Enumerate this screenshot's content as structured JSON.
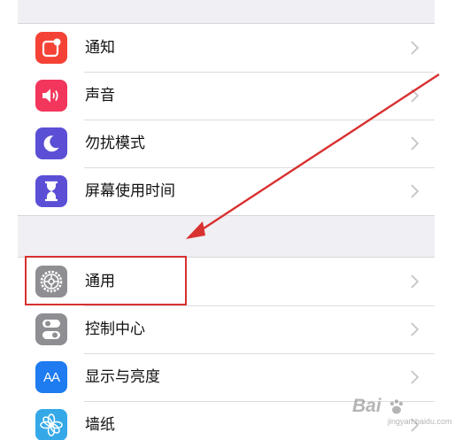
{
  "settings": {
    "group1": [
      {
        "label": "通知",
        "icon": "notifications-icon",
        "color": "#f44336"
      },
      {
        "label": "声音",
        "icon": "sound-icon",
        "color": "#f2365c"
      },
      {
        "label": "勿扰模式",
        "icon": "moon-icon",
        "color": "#5b4fd6"
      },
      {
        "label": "屏幕使用时间",
        "icon": "hourglass-icon",
        "color": "#5b4fd6"
      }
    ],
    "group2": [
      {
        "label": "通用",
        "icon": "gear-icon",
        "color": "#8e8e93"
      },
      {
        "label": "控制中心",
        "icon": "toggles-icon",
        "color": "#8e8e93"
      },
      {
        "label": "显示与亮度",
        "icon": "display-aa-icon",
        "color": "#1e7bf0",
        "icon_text": "AA"
      },
      {
        "label": "墙纸",
        "icon": "wallpaper-flower-icon",
        "color": "#35a9e8"
      }
    ]
  },
  "watermark": {
    "text": "Bai",
    "sub": "jingyan.baidu.com"
  }
}
